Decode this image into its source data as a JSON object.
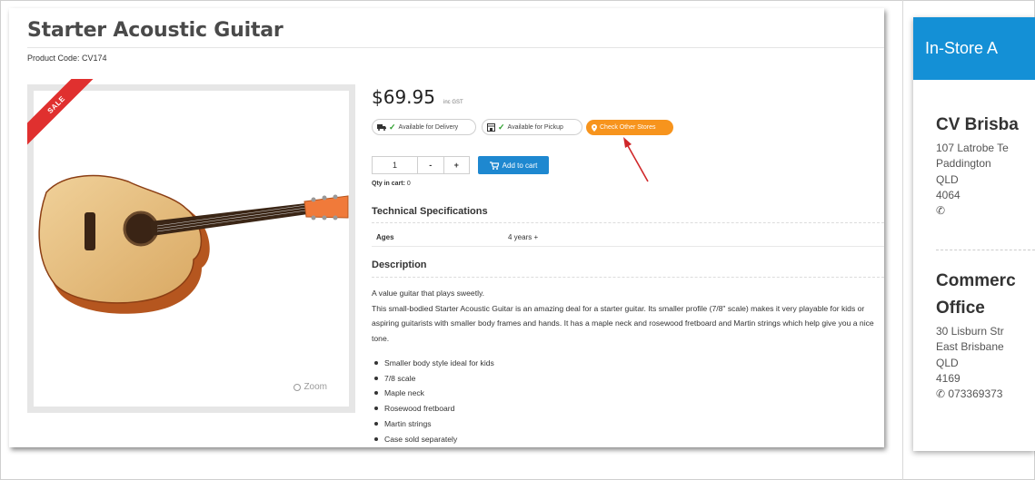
{
  "product": {
    "title": "Starter Acoustic Guitar",
    "code": "Product Code: CV174",
    "sale_badge": "SALE",
    "zoom_label": "Zoom",
    "price": "$69.95",
    "price_note": "inc GST",
    "availability": [
      {
        "icon": "truck-icon",
        "label": "Available for Delivery"
      },
      {
        "icon": "store-icon",
        "label": "Available for Pickup"
      }
    ],
    "check_stores_label": "Check Other Stores",
    "quantity": "1",
    "minus_label": "-",
    "plus_label": "+",
    "add_to_cart_label": "Add to cart",
    "qty_in_cart_label": "Qty in cart:",
    "qty_in_cart_value": "0",
    "tech_specs_title": "Technical Specifications",
    "specs": [
      {
        "key": "Ages",
        "value": "4 years +"
      }
    ],
    "description_title": "Description",
    "description_lines": [
      "A value guitar that plays sweetly.",
      "This small-bodied Starter Acoustic Guitar is an amazing deal for a starter guitar. Its smaller profile (7/8\" scale) makes it very playable for kids or aspiring guitarists with smaller body frames and hands. It has a maple neck and rosewood fretboard and Martin strings which help give you a nice tone."
    ],
    "features": [
      "Smaller body style ideal for kids",
      "7/8 scale",
      "Maple neck",
      "Rosewood fretboard",
      "Martin strings",
      "Case sold separately"
    ]
  },
  "sidebar": {
    "title": "In-Store A",
    "stores": [
      {
        "name": "CV Brisba",
        "lines": [
          "107 Latrobe Te",
          "Paddington",
          "QLD",
          "4064"
        ],
        "phone": ""
      },
      {
        "name_line1": "Commerc",
        "name_line2": "Office",
        "lines": [
          "30 Lisburn Str",
          "East Brisbane",
          "QLD",
          "4169"
        ],
        "phone": "073369373"
      }
    ]
  },
  "colors": {
    "accent_blue": "#1490d6",
    "button_blue": "#1e88d0",
    "sale_red": "#e0302f",
    "check_orange": "#f7941d",
    "arrow_red": "#d0282a"
  }
}
